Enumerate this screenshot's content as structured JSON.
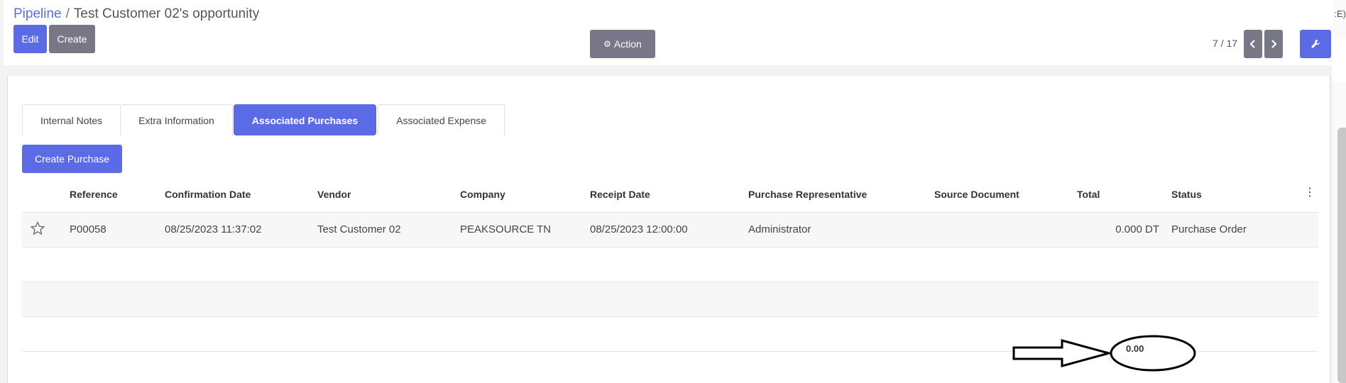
{
  "breadcrumb": {
    "parent": "Pipeline",
    "separator": "/",
    "current": "Test Customer 02's opportunity"
  },
  "toolbar": {
    "edit_label": "Edit",
    "create_label": "Create",
    "action_label": "Action"
  },
  "pager": {
    "value": "7 / 17"
  },
  "edge_text": ":E)",
  "tabs": [
    {
      "label": "Internal Notes",
      "active": false
    },
    {
      "label": "Extra Information",
      "active": false
    },
    {
      "label": "Associated Purchases",
      "active": true
    },
    {
      "label": "Associated Expense",
      "active": false
    }
  ],
  "create_purchase_label": "Create Purchase",
  "table": {
    "columns": [
      "Reference",
      "Confirmation Date",
      "Vendor",
      "Company",
      "Receipt Date",
      "Purchase Representative",
      "Source Document",
      "Total",
      "Status"
    ],
    "rows": [
      {
        "reference": "P00058",
        "confirmation_date": "08/25/2023 11:37:02",
        "vendor": "Test Customer 02",
        "company": "PEAKSOURCE TN",
        "receipt_date": "08/25/2023 12:00:00",
        "purchase_representative": "Administrator",
        "source_document": "",
        "total": "0.000 DT",
        "status": "Purchase Order"
      }
    ],
    "footer_total": "0.00"
  },
  "colors": {
    "primary": "#5b6be5",
    "secondary": "#777788"
  },
  "icons": [
    "gear-icon",
    "chevron-left-icon",
    "chevron-right-icon",
    "wrench-icon",
    "star-icon",
    "kebab-icon",
    "arrow-annotation"
  ]
}
